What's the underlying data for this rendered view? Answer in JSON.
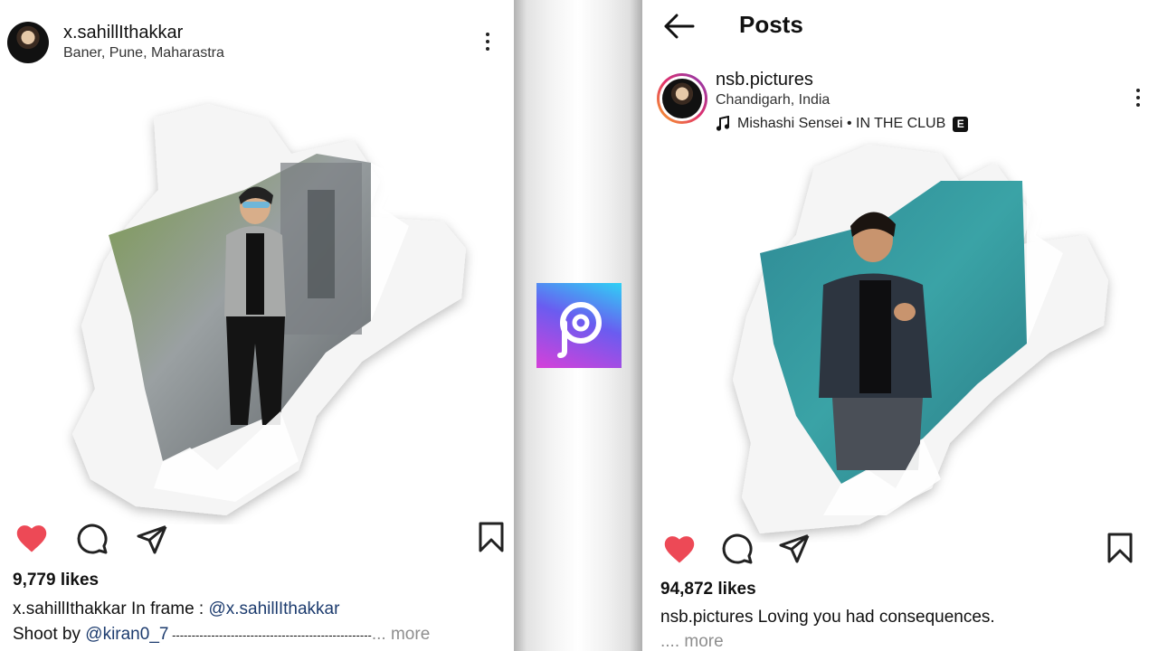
{
  "left_post": {
    "username": "x.sahillIthakkar",
    "location": "Baner, Pune, Maharastra",
    "likes": "9,779 likes",
    "caption_user": "x.sahillIthakkar",
    "caption_text": " In frame : ",
    "caption_mention": "@x.sahillIthakkar",
    "line2_prefix": "Shoot by ",
    "line2_mention": "@kiran0_7",
    "line2_dashes": " ---------------------------------------------------",
    "more": "... more"
  },
  "right_post": {
    "header_title": "Posts",
    "username": "nsb.pictures",
    "location": "Chandigarh, India",
    "music": "Mishashi Sensei • IN THE CLUB",
    "explicit_badge": "E",
    "likes": "94,872 likes",
    "caption_user": "nsb.pictures",
    "caption_text": " Loving you had consequences.",
    "more": ".... more"
  },
  "icons": {
    "heart": "heart-icon",
    "comment": "comment-icon",
    "share": "share-icon",
    "bookmark": "bookmark-icon",
    "back": "back-arrow-icon",
    "menu": "more-options-icon",
    "music": "music-note-icon",
    "app_logo": "picsart-logo"
  },
  "colors": {
    "heart_red": "#ed4956",
    "mention_blue": "#1c3b6e",
    "more_gray": "#8e8e8e"
  }
}
